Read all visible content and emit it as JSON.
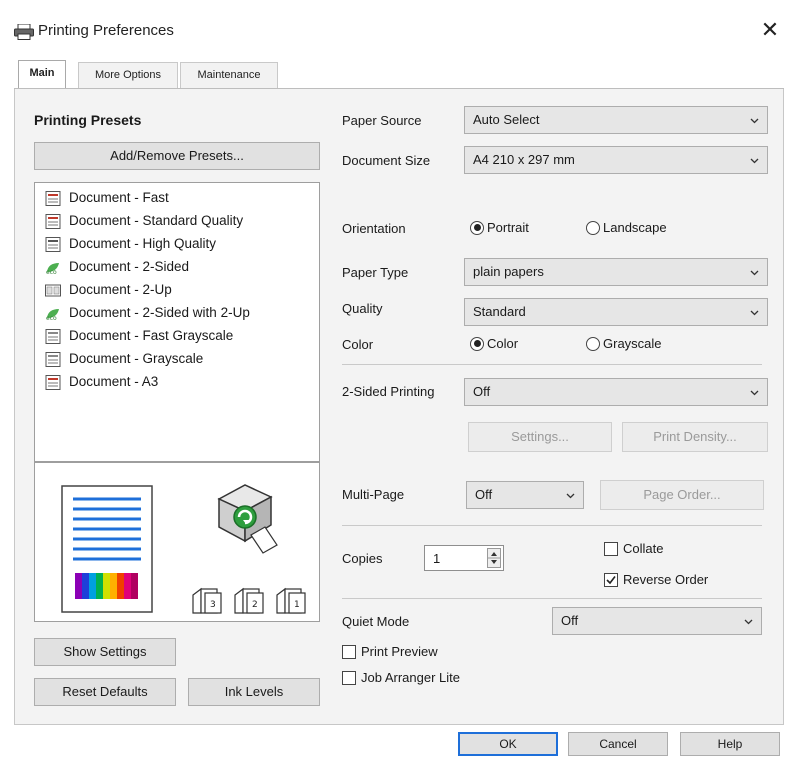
{
  "window": {
    "title": "Printing Preferences",
    "close_label": "✕"
  },
  "tabs": [
    {
      "label": "Main",
      "active": true
    },
    {
      "label": "More Options",
      "active": false
    },
    {
      "label": "Maintenance",
      "active": false
    }
  ],
  "presets": {
    "heading": "Printing Presets",
    "add_remove_label": "Add/Remove Presets...",
    "items": [
      {
        "label": "Document - Fast",
        "icon": "document-icon"
      },
      {
        "label": "Document - Standard Quality",
        "icon": "document-icon"
      },
      {
        "label": "Document - High Quality",
        "icon": "document-icon"
      },
      {
        "label": "Document - 2-Sided",
        "icon": "eco-icon"
      },
      {
        "label": "Document - 2-Up",
        "icon": "two-up-icon"
      },
      {
        "label": "Document - 2-Sided with 2-Up",
        "icon": "eco-icon"
      },
      {
        "label": "Document - Fast Grayscale",
        "icon": "document-icon"
      },
      {
        "label": "Document - Grayscale",
        "icon": "document-icon"
      },
      {
        "label": "Document - A3",
        "icon": "document-icon"
      }
    ],
    "show_settings_label": "Show Settings",
    "reset_defaults_label": "Reset Defaults",
    "ink_levels_label": "Ink Levels"
  },
  "settings": {
    "paper_source": {
      "label": "Paper Source",
      "value": "Auto Select"
    },
    "document_size": {
      "label": "Document Size",
      "value": "A4 210 x 297 mm"
    },
    "orientation": {
      "label": "Orientation",
      "portrait": "Portrait",
      "landscape": "Landscape",
      "selected": "portrait"
    },
    "paper_type": {
      "label": "Paper Type",
      "value": "plain papers"
    },
    "quality": {
      "label": "Quality",
      "value": "Standard"
    },
    "color": {
      "label": "Color",
      "color": "Color",
      "grayscale": "Grayscale",
      "selected": "color"
    },
    "two_sided": {
      "label": "2-Sided Printing",
      "value": "Off",
      "settings_label": "Settings...",
      "density_label": "Print Density..."
    },
    "multi_page": {
      "label": "Multi-Page",
      "value": "Off",
      "page_order_label": "Page Order..."
    },
    "copies": {
      "label": "Copies",
      "value": "1"
    },
    "collate": {
      "label": "Collate",
      "checked": false
    },
    "reverse_order": {
      "label": "Reverse Order",
      "checked": true
    },
    "quiet_mode": {
      "label": "Quiet Mode",
      "value": "Off"
    },
    "print_preview": {
      "label": "Print Preview",
      "checked": false
    },
    "job_arranger": {
      "label": "Job Arranger Lite",
      "checked": false
    }
  },
  "footer": {
    "ok_label": "OK",
    "cancel_label": "Cancel",
    "help_label": "Help"
  },
  "colors": {
    "accent_blue": "#1e6fd9",
    "eco_green": "#4caf50"
  }
}
